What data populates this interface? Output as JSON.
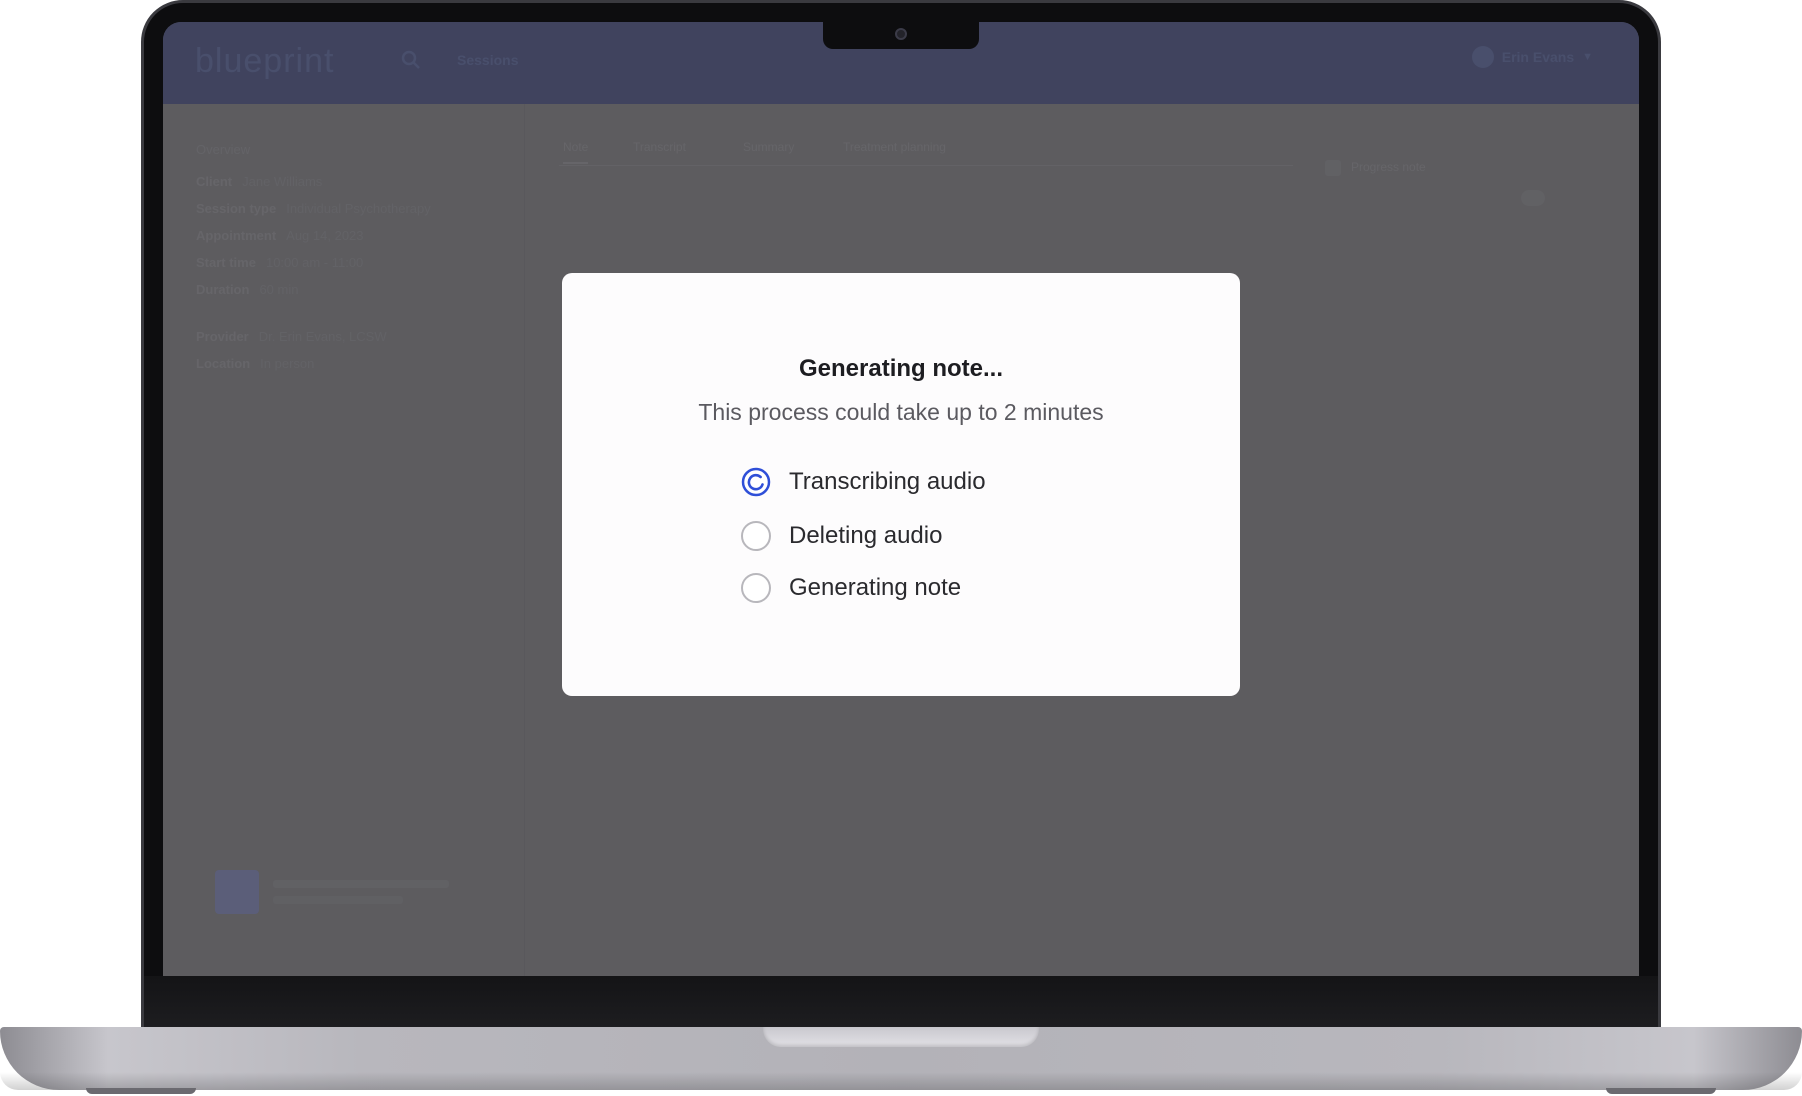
{
  "app": {
    "logo": "blueprint",
    "nav_label": "Sessions",
    "user_name": "Erin Evans"
  },
  "sidebar": {
    "title": "Overview",
    "rows": [
      {
        "key": "Client",
        "value": "Jane Williams"
      },
      {
        "key": "Session type",
        "value": "Individual Psychotherapy"
      },
      {
        "key": "Appointment",
        "value": "Aug 14, 2023"
      },
      {
        "key": "Start time",
        "value": "10:00 am - 11:00"
      },
      {
        "key": "Duration",
        "value": "60 min"
      }
    ],
    "rows2": [
      {
        "key": "Provider",
        "value": "Dr. Erin Evans, LCSW"
      },
      {
        "key": "Location",
        "value": "In person"
      }
    ]
  },
  "tabs": [
    "Note",
    "Transcript",
    "Summary",
    "Treatment planning"
  ],
  "right_panel_label": "Progress note",
  "modal": {
    "title": "Generating note...",
    "subtitle": "This process could take up to 2 minutes",
    "steps": [
      {
        "label": "Transcribing audio",
        "state": "in-progress"
      },
      {
        "label": "Deleting audio",
        "state": "pending"
      },
      {
        "label": "Generating note",
        "state": "pending"
      }
    ]
  },
  "colors": {
    "accent": "#2f4fd8",
    "header_bg": "#2a3160",
    "overlay": "#5f5e62"
  },
  "icons": {
    "active_step": "spinner-icon",
    "pending_step": "empty-radio-icon",
    "header_search": "search-icon"
  }
}
